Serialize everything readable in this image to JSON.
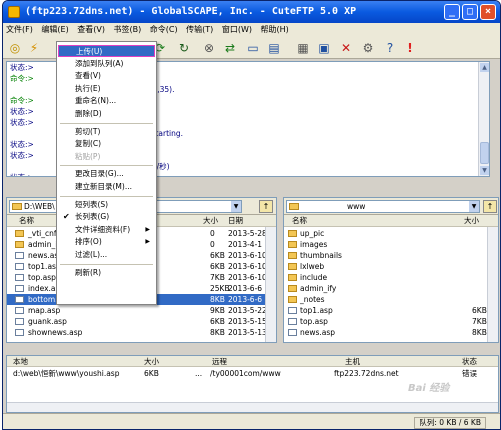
{
  "window": {
    "title": "(ftp223.72dns.net) - GlobalSCAPE, Inc. - CuteFTP 5.0 XP"
  },
  "menubar": [
    "文件(F)",
    "编辑(E)",
    "查看(V)",
    "书签(B)",
    "命令(C)",
    "传输(T)",
    "窗口(W)",
    "帮助(H)"
  ],
  "toolbar_icons": [
    "connect-icon",
    "quick-connect-icon",
    "download-icon",
    "upload-icon",
    "refresh-icon",
    "stop-icon",
    "reconnect-icon",
    "view-icon",
    "view-list-icon",
    "site-manager-icon",
    "log-icon",
    "delete-icon",
    "settings-icon",
    "help-icon",
    "alert-icon"
  ],
  "log": [
    {
      "label": "状态:>",
      "text": "",
      "type": "s"
    },
    {
      "label": "命令:>",
      "text": "",
      "type": "c"
    },
    {
      "label": "",
      "text": ",142,253,207,4,35).",
      "type": "s"
    },
    {
      "label": "命令:>",
      "text": "",
      "type": "c"
    },
    {
      "label": "状态:>",
      "text": "",
      "type": "s"
    },
    {
      "label": "状态:>",
      "text": "",
      "type": "s"
    },
    {
      "label": "",
      "text": "pen; Transfer starting.",
      "type": "s"
    },
    {
      "label": "状态:>",
      "text": "",
      "type": "s"
    },
    {
      "label": "状态:>",
      "text": "",
      "type": "s"
    },
    {
      "label": "",
      "text": "3/秒 (4364 字节/秒)",
      "type": "s"
    },
    {
      "label": "状态:>",
      "text": "",
      "type": "s"
    }
  ],
  "left_pane": {
    "path": "D:\\WEB\\",
    "columns": {
      "name": "名称",
      "size": "大小",
      "date": "日期"
    },
    "rows": [
      {
        "name": "_vti_cnf",
        "size": "0",
        "date": "2013-5-28",
        "type": "dir"
      },
      {
        "name": "admin_ify",
        "size": "0",
        "date": "2013-4-1",
        "type": "dir"
      },
      {
        "name": "news.asp",
        "size": "6KB",
        "date": "2013-6-10",
        "type": "file"
      },
      {
        "name": "top1.asp",
        "size": "6KB",
        "date": "2013-6-10",
        "type": "file"
      },
      {
        "name": "top.asp",
        "size": "7KB",
        "date": "2013-6-10",
        "type": "file"
      },
      {
        "name": "index.asp",
        "size": "25KB",
        "date": "2013-6-6",
        "type": "file"
      },
      {
        "name": "bottom.asp",
        "size": "8KB",
        "date": "2013-6-6",
        "type": "file",
        "selected": true
      },
      {
        "name": "map.asp",
        "size": "9KB",
        "date": "2013-5-22",
        "type": "file"
      },
      {
        "name": "guank.asp",
        "size": "6KB",
        "date": "2013-5-15",
        "type": "file"
      },
      {
        "name": "shownews.asp",
        "size": "8KB",
        "date": "2013-5-13",
        "type": "file"
      }
    ]
  },
  "right_pane": {
    "path": "www",
    "columns": {
      "name": "名称",
      "size": "大小"
    },
    "rows": [
      {
        "name": "up_pic",
        "size": "",
        "type": "dir"
      },
      {
        "name": "images",
        "size": "",
        "type": "dir"
      },
      {
        "name": "thumbnails",
        "size": "",
        "type": "dir"
      },
      {
        "name": "lxlweb",
        "size": "",
        "type": "dir"
      },
      {
        "name": "include",
        "size": "",
        "type": "dir"
      },
      {
        "name": "admin_ify",
        "size": "",
        "type": "dir"
      },
      {
        "name": "_notes",
        "size": "",
        "type": "dir"
      },
      {
        "name": "top1.asp",
        "size": "6KB",
        "type": "file"
      },
      {
        "name": "top.asp",
        "size": "7KB",
        "type": "file"
      },
      {
        "name": "news.asp",
        "size": "8KB",
        "type": "file"
      }
    ]
  },
  "queue": {
    "columns": {
      "local": "本地",
      "size": "大小",
      "remote": "远程",
      "host": "主机",
      "status": "状态"
    },
    "rows": [
      {
        "local": "d:\\web\\恒新\\www\\youshi.asp",
        "size": "6KB",
        "arrow": "...",
        "remote": "/ty00001com/www",
        "host": "ftp223.72dns.net",
        "status": "错误"
      }
    ]
  },
  "statusbar": {
    "queue": "队列: 0 KB / 6 KB"
  },
  "context_menu": [
    {
      "label": "上传(U)",
      "highlight": true
    },
    {
      "label": "添加到队列(A)"
    },
    {
      "label": "查看(V)"
    },
    {
      "label": "执行(E)"
    },
    {
      "label": "重命名(N)..."
    },
    {
      "label": "删除(D)"
    },
    {
      "sep": true
    },
    {
      "label": "剪切(T)"
    },
    {
      "label": "复制(C)"
    },
    {
      "label": "粘贴(P)",
      "disabled": true
    },
    {
      "sep": true
    },
    {
      "label": "更改目录(G)..."
    },
    {
      "label": "建立新目录(M)..."
    },
    {
      "sep": true
    },
    {
      "label": "短列表(S)"
    },
    {
      "label": "长列表(G)",
      "checked": true
    },
    {
      "label": "文件详细资料(F)",
      "submenu": true
    },
    {
      "label": "排序(O)",
      "submenu": true
    },
    {
      "label": "过滤(L)..."
    },
    {
      "sep": true
    },
    {
      "label": "刷新(R)"
    }
  ],
  "watermark": "Bai 经验"
}
